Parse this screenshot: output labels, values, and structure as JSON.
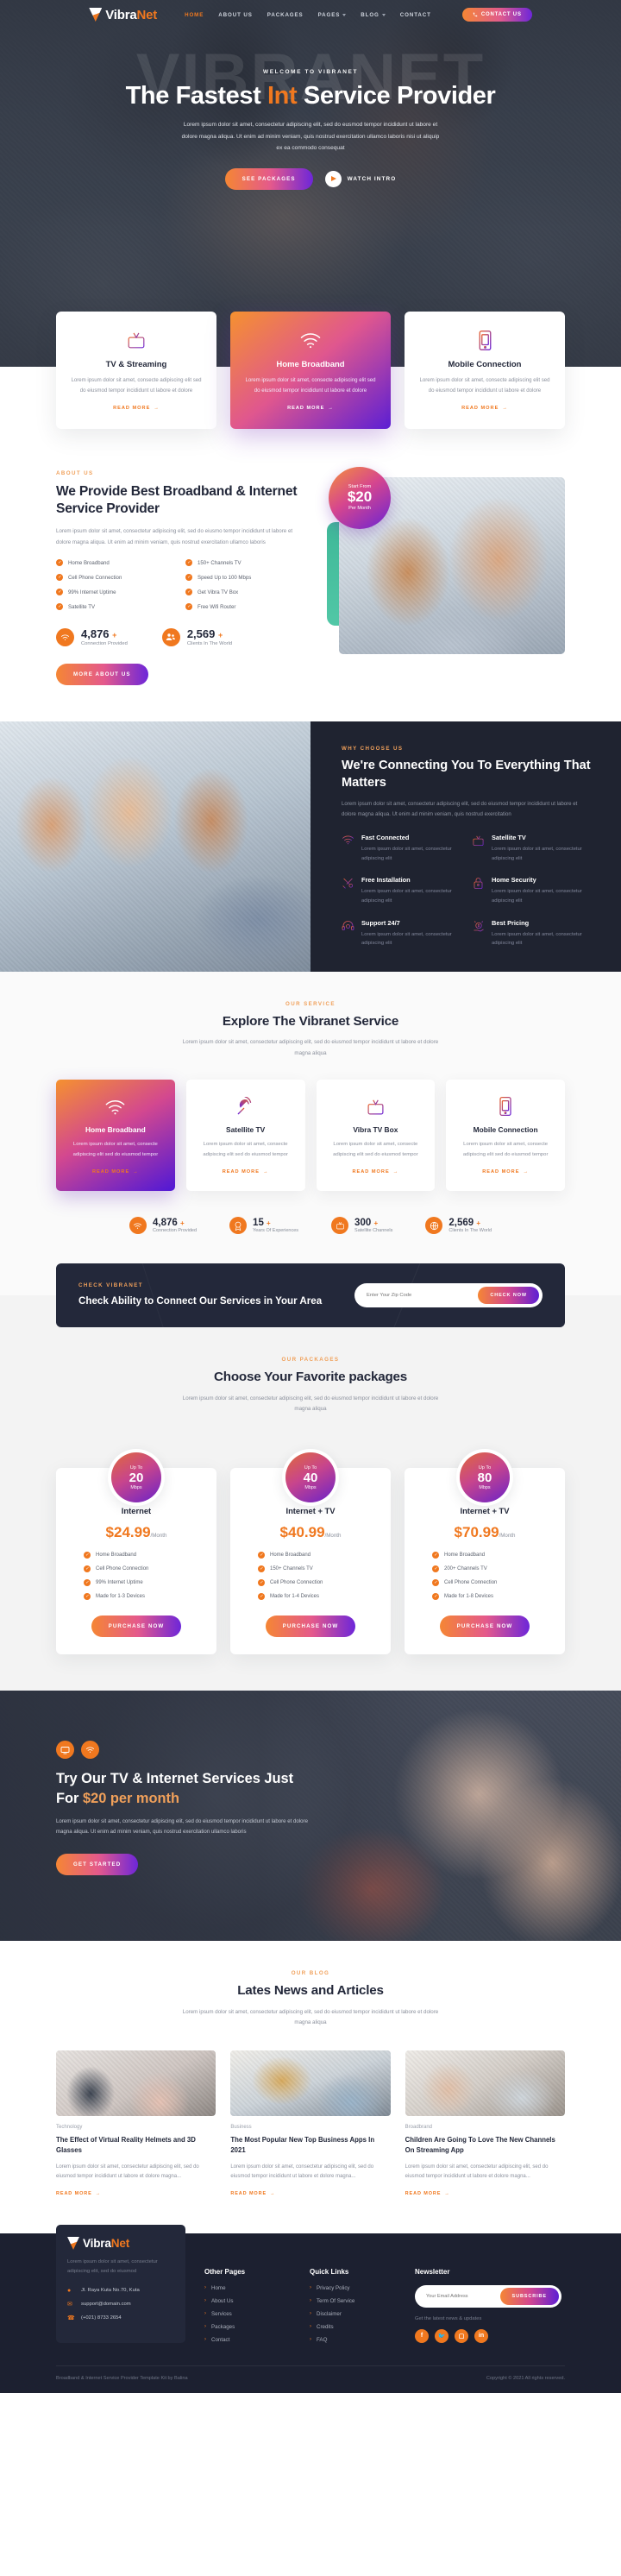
{
  "brand": {
    "name_part1": "Vibra",
    "name_part2": "Net",
    "accent": "#f0781f",
    "logo_icon": "triangle-logo-icon"
  },
  "nav": {
    "items": [
      {
        "label": "HOME",
        "active": true,
        "caret": false
      },
      {
        "label": "ABOUT US",
        "active": false,
        "caret": false
      },
      {
        "label": "PACKAGES",
        "active": false,
        "caret": false
      },
      {
        "label": "PAGES",
        "active": false,
        "caret": true
      },
      {
        "label": "BLOG",
        "active": false,
        "caret": true
      },
      {
        "label": "CONTACT",
        "active": false,
        "caret": false
      }
    ],
    "cta_label": "CONTACT US",
    "cta_icon": "phone-icon"
  },
  "hero": {
    "ghost_text": "VIBRANET",
    "eyebrow": "WELCOME TO VIBRANET",
    "title_a": "The Fastest ",
    "title_highlight": "Int",
    "title_b": " Service Provider",
    "paragraph": "Lorem ipsum dolor sit amet, consectetur adipiscing elit, sed do eusmod tempor incididunt ut labore et dolore magna aliqua. Ut enim ad minim veniam, quis nostrud exercitation ullamco laboris nisi ut aliquip ex ea commodo consequat",
    "primary_btn": "SEE PACKAGES",
    "secondary_btn": "WATCH INTRO",
    "play_icon": "play-icon"
  },
  "service_cards": [
    {
      "icon": "tv-icon",
      "title": "TV & Streaming",
      "text": "Lorem ipsum dolor sit amet, consecte adipiscing elit sed do eiusmod tempor incididunt ut labore et dolore",
      "link": "READ MORE",
      "highlight": false
    },
    {
      "icon": "wifi-icon",
      "title": "Home Broadband",
      "text": "Lorem ipsum dolor sit amet, consecte adipiscing elit sed do eiusmod tempor incididunt ut labore et dolore",
      "link": "READ MORE",
      "highlight": true
    },
    {
      "icon": "mobile-icon",
      "title": "Mobile Connection",
      "text": "Lorem ipsum dolor sit amet, consecte adipiscing elit sed do eiusmod tempor incididunt ut labore et dolore",
      "link": "READ MORE",
      "highlight": false
    }
  ],
  "about": {
    "eyebrow": "ABOUT US",
    "title": "We Provide Best Broadband & Internet Service Provider",
    "paragraph": "Lorem ipsum dolor sit amet, consectetur adipiscing elit, sed do eiusmo tempor incididunt ut labore et dolore magna aliqua. Ut enim ad minim veniam, quis nostrud exercitation ullamco laboris",
    "features": [
      "Home Broadband",
      "150+ Channels TV",
      "Cell Phone Connection",
      "Speed Up to 100 Mbps",
      "99% Internet Uptime",
      "Get Vibra TV Box",
      "Satellite TV",
      "Free Wifi Router"
    ],
    "counters": [
      {
        "icon": "wifi-icon",
        "value": "4,876",
        "plus": "+",
        "label": "Connection Provided"
      },
      {
        "icon": "users-icon",
        "value": "2,569",
        "plus": "+",
        "label": "Clients In The World"
      }
    ],
    "button": "MORE ABOUT US",
    "badge": {
      "top": "Start From",
      "value": "$20",
      "bottom": "Per Month"
    }
  },
  "why": {
    "eyebrow": "WHY CHOOSE US",
    "title": "We're Connecting You To Everything That Matters",
    "paragraph": "Lorem ipsum dolor sit amet, consectetur adipiscing elit, sed do eiusmod tempor incididunt ut labore et dolore magna aliqua. Ut enim ad minim veniam, quis nostrud exercitation",
    "items": [
      {
        "icon": "wifi-icon",
        "title": "Fast Connected",
        "text": "Lorem ipsum dolor sit amet, consectetur adipiscing elit"
      },
      {
        "icon": "tv-icon",
        "title": "Satellite TV",
        "text": "Lorem ipsum dolor sit amet, consectetur adipiscing elit"
      },
      {
        "icon": "tools-icon",
        "title": "Free Installation",
        "text": "Lorem ipsum dolor sit amet, consectetur adipiscing elit"
      },
      {
        "icon": "lock-icon",
        "title": "Home Security",
        "text": "Lorem ipsum dolor sit amet, consectetur adipiscing elit"
      },
      {
        "icon": "headset-icon",
        "title": "Support 24/7",
        "text": "Lorem ipsum dolor sit amet, consectetur adipiscing elit"
      },
      {
        "icon": "coin-hand-icon",
        "title": "Best Pricing",
        "text": "Lorem ipsum dolor sit amet, consectetur adipiscing elit"
      }
    ]
  },
  "our_service": {
    "eyebrow": "OUR SERVICE",
    "title": "Explore The Vibranet Service",
    "paragraph": "Lorem ipsum dolor sit amet, consectetur adipiscing elit, sed do eiusmod tempor incididunt ut labore et dolore magna aliqua",
    "cards": [
      {
        "icon": "wifi-icon",
        "title": "Home Broadband",
        "text": "Lorem ipsum dolor sit amet, consecte adipiscing elit sed do eiusmod tempor",
        "link": "READ MORE",
        "highlight": true
      },
      {
        "icon": "satellite-icon",
        "title": "Satellite TV",
        "text": "Lorem ipsum dolor sit amet, consecte adipiscing elit sed do eiusmod tempor",
        "link": "READ MORE",
        "highlight": false
      },
      {
        "icon": "tv-icon",
        "title": "Vibra TV Box",
        "text": "Lorem ipsum dolor sit amet, consecte adipiscing elit sed do eiusmod tempor",
        "link": "READ MORE",
        "highlight": false
      },
      {
        "icon": "mobile-icon",
        "title": "Mobile Connection",
        "text": "Lorem ipsum dolor sit amet, consecte adipiscing elit sed do eiusmod tempor",
        "link": "READ MORE",
        "highlight": false
      }
    ]
  },
  "stats": [
    {
      "icon": "wifi-icon",
      "value": "4,876",
      "plus": "+",
      "label": "Connection Provided"
    },
    {
      "icon": "badge-icon",
      "value": "15",
      "plus": "+",
      "label": "Years Of Experiences"
    },
    {
      "icon": "tv-icon",
      "value": "300",
      "plus": "+",
      "label": "Satellite Channels"
    },
    {
      "icon": "globe-icon",
      "value": "2,569",
      "plus": "+",
      "label": "Clients In The World"
    }
  ],
  "check": {
    "eyebrow": "CHECK VIBRANET",
    "title": "Check Ability to Connect Our Services in Your Area",
    "placeholder": "Enter Your Zip Code",
    "button": "CHECK NOW",
    "value": ""
  },
  "packages": {
    "eyebrow": "OUR PACKAGES",
    "title": "Choose Your Favorite packages",
    "paragraph": "Lorem ipsum dolor sit amet, consectetur adipiscing elit, sed do eiusmod tempor incididunt ut labore et dolore magna aliqua",
    "items": [
      {
        "speed_top": "Up To",
        "speed": "20",
        "speed_unit": "Mbps",
        "name": "Internet",
        "price": "$24.99",
        "period": "/Month",
        "features": [
          "Home Broadband",
          "Cell Phone Connection",
          "99% Internet Uptime",
          "Made for 1-3 Devices"
        ],
        "button": "PURCHASE NOW"
      },
      {
        "speed_top": "Up To",
        "speed": "40",
        "speed_unit": "Mbps",
        "name": "Internet + TV",
        "price": "$40.99",
        "period": "/Month",
        "features": [
          "Home Broadband",
          "150+ Channels TV",
          "Cell Phone Connection",
          "Made for 1-4 Devices"
        ],
        "button": "PURCHASE NOW"
      },
      {
        "speed_top": "Up To",
        "speed": "80",
        "speed_unit": "Mbps",
        "name": "Internet + TV",
        "price": "$70.99",
        "period": "/Month",
        "features": [
          "Home Broadband",
          "200+ Channels TV",
          "Cell Phone Connection",
          "Made for 1-8 Devices"
        ],
        "button": "PURCHASE NOW"
      }
    ]
  },
  "cta": {
    "icons": [
      "tv-monitor-icon",
      "wifi-icon"
    ],
    "title_a": "Try Our TV & Internet Services Just For ",
    "title_highlight": "$20 per month",
    "paragraph": "Lorem ipsum dolor sit amet, consectetur adipiscing elit, sed do eiusmod tempor incididunt ut labore et dolore magna aliqua. Ut enim ad minim veniam, quis nostrud exercitation ullamco laboris",
    "button": "GET STARTED"
  },
  "blog": {
    "eyebrow": "OUR BLOG",
    "title": "Lates News and Articles",
    "paragraph": "Lorem ipsum dolor sit amet, consectetur adipiscing elit, sed do eiusmod tempor incididunt ut labore et dolore magna aliqua",
    "posts": [
      {
        "category": "Technology",
        "title": "The Effect of Virtual Reality Helmets and 3D Glasses",
        "excerpt": "Lorem ipsum dolor sit amet, consectetur adipiscing elit, sed do eiusmod tempor incididunt ut labore et dolore magna...",
        "link": "READ MORE"
      },
      {
        "category": "Business",
        "title": "The Most Popular New Top Business Apps In 2021",
        "excerpt": "Lorem ipsum dolor sit amet, consectetur adipiscing elit, sed do eiusmod tempor incididunt ut labore et dolore magna...",
        "link": "READ MORE"
      },
      {
        "category": "Broadbrand",
        "title": "Children Are Going To Love The New Channels On Streaming App",
        "excerpt": "Lorem ipsum dolor sit amet, consectetur adipiscing elit, sed do eiusmod tempor incididunt ut labore et dolore magna...",
        "link": "READ MORE"
      }
    ]
  },
  "footer": {
    "description": "Lorem ipsum dolor sit amet, consectetur adipiscing elit, sed do eiusmod",
    "contacts": [
      {
        "icon": "location-pin-icon",
        "text": "Jl. Raya Kuta No.70, Kuta"
      },
      {
        "icon": "envelope-icon",
        "text": "support@domain.com"
      },
      {
        "icon": "phone-icon",
        "text": "(+021) 8733 2654"
      }
    ],
    "other_pages": {
      "heading": "Other Pages",
      "links": [
        "Home",
        "About Us",
        "Services",
        "Packages",
        "Contact"
      ]
    },
    "quick_links": {
      "heading": "Quick Links",
      "links": [
        "Privacy Policy",
        "Term Of Service",
        "Disclaimer",
        "Credits",
        "FAQ"
      ]
    },
    "newsletter": {
      "heading": "Newsletter",
      "placeholder": "Your Email Address",
      "value": "",
      "button": "SUBSCRIBE",
      "note": "Get the latest news & updates"
    },
    "socials": [
      "facebook-icon",
      "twitter-icon",
      "instagram-icon",
      "linkedin-icon"
    ],
    "credit": "Broadband & Internet Service Provider Template Kit by Balina",
    "copyright": "Copyright © 2021 All rights reserved."
  }
}
